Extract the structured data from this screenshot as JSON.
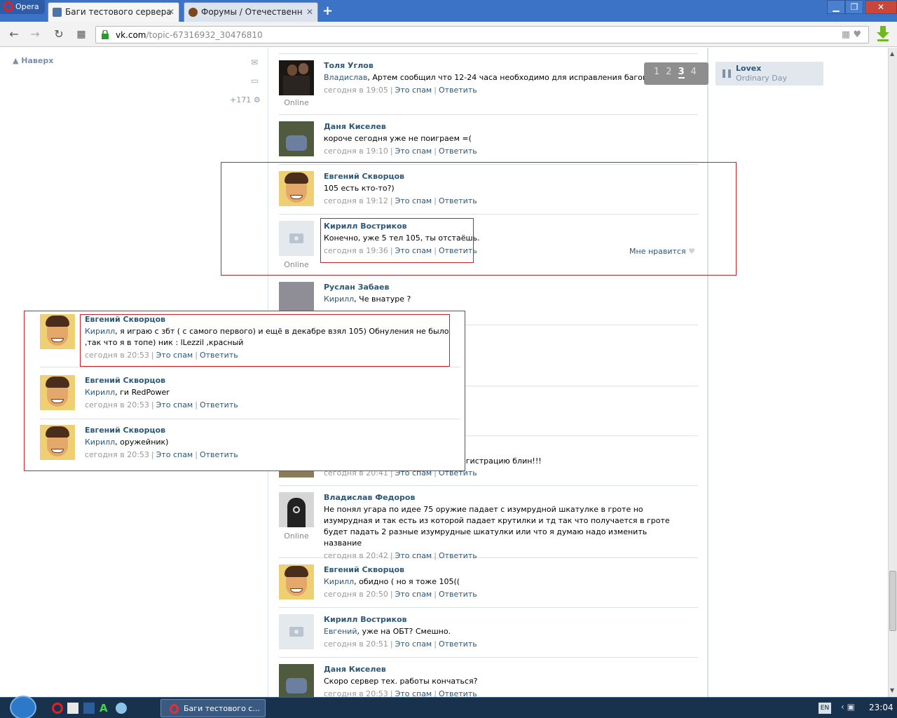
{
  "browser": {
    "menu_label": "Opera",
    "tabs": [
      {
        "title": "Баги тестового сервера",
        "active": true
      },
      {
        "title": "Форумы / Отечественн",
        "active": false
      }
    ],
    "url_domain": "vk.com",
    "url_path": "/topic-67316932_30476810"
  },
  "left": {
    "to_top": "Наверх",
    "counter": "+171"
  },
  "pager": {
    "pages": [
      "1",
      "2",
      "3",
      "4"
    ],
    "current": "3"
  },
  "audio": {
    "artist": "Lovex",
    "song": "Ordinary Day"
  },
  "labels": {
    "spam": "Это спам",
    "reply": "Ответить",
    "online": "Online",
    "like": "Мне нравится"
  },
  "posts": [
    {
      "author": "Толя Углов",
      "to": "Владислав",
      "text": ", Артем сообщил что 12-24 часа необходимо для исправления багов из списка)",
      "time": "сегодня в 19:05",
      "online": "Online"
    },
    {
      "author": "Даня Киселев",
      "to": "",
      "text": "короче сегодня уже не поиграем =(",
      "time": "сегодня в 19:10"
    },
    {
      "author": "Евгений Скворцов",
      "to": "",
      "text": "105 есть кто-то?)",
      "time": "сегодня в 19:12"
    },
    {
      "author": "Кирилл Востриков",
      "to": "",
      "text": "Конечно, уже 5 тел 105, ты отстаёшь.",
      "time": "сегодня в 19:36",
      "online": "Online"
    },
    {
      "author": "Руслан Забаев",
      "to": "Кирилл",
      "text": ", Че внатуре ?",
      "time": ""
    },
    {
      "author": "",
      "to": "",
      "text": "егистрацию блин!!!",
      "time": "сегодня в 20:41"
    },
    {
      "author": "Владислав Федоров",
      "to": "",
      "text": "Не понял угара по идее 75 оружие падает с изумрудной шкатулке в гроте но изумрудная и так есть из которой падает крутилки и тд так что получается в гроте будет падать 2 разные изумрудные шкатулки или что я думаю надо изменить название",
      "time": "сегодня в 20:42",
      "online": "Online"
    },
    {
      "author": "Евгений Скворцов",
      "to": "Кирилл",
      "text": ", обидно ( но я тоже 105((",
      "time": "сегодня в 20:50"
    },
    {
      "author": "Кирилл Востриков",
      "to": "Евгений",
      "text": ", уже на ОБТ? Смешно.",
      "time": "сегодня в 20:51"
    },
    {
      "author": "Даня Киселев",
      "to": "",
      "text": "Скоро сервер тех. работы кончаться?",
      "time": "сегодня в 20:53"
    }
  ],
  "overlay_posts": [
    {
      "author": "Евгений Скворцов",
      "to": "Кирилл",
      "text": ", я играю с збт ( с самого первого) и ещё в декабре взял 105) Обнуления не было ,так что я в топе) ник : lLezzil ,красный",
      "time": "сегодня в 20:53"
    },
    {
      "author": "Евгений Скворцов",
      "to": "Кирилл",
      "text": ", ги RedPower",
      "time": "сегодня в 20:53"
    },
    {
      "author": "Евгений Скворцов",
      "to": "Кирилл",
      "text": ", оружейник)",
      "time": "сегодня в 20:53"
    }
  ],
  "taskbar": {
    "task_label": "Баги тестового с...",
    "lang": "EN",
    "clock": "23:04"
  },
  "colors": {
    "link": "#2b587a",
    "highlight": "#c0272d",
    "title_bar": "#3d73c6",
    "taskbar": "#18324e"
  }
}
